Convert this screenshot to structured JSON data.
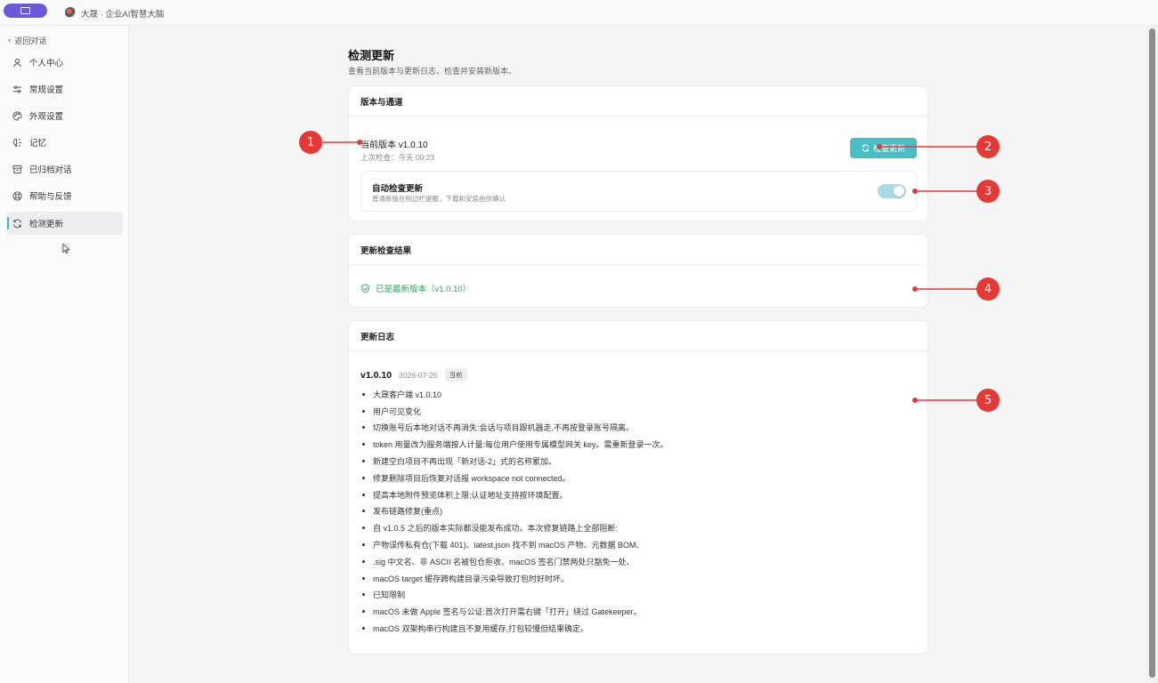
{
  "titlebar": {
    "app_title": "大晟 · 企业AI智慧大脑"
  },
  "sidebar": {
    "back_label": "返回对话",
    "items": [
      {
        "label": "个人中心",
        "icon": "user-icon"
      },
      {
        "label": "常规设置",
        "icon": "sliders-icon"
      },
      {
        "label": "外观设置",
        "icon": "palette-icon"
      },
      {
        "label": "记忆",
        "icon": "memory-icon"
      },
      {
        "label": "已归档对话",
        "icon": "archive-icon"
      },
      {
        "label": "帮助与反馈",
        "icon": "help-icon"
      },
      {
        "label": "检测更新",
        "icon": "refresh-icon",
        "active": true
      }
    ]
  },
  "page": {
    "title": "检测更新",
    "subtitle": "查看当前版本与更新日志，检查并安装新版本。"
  },
  "version_card": {
    "title": "版本与通道",
    "current_version": "当前版本 v1.0.10",
    "last_check": "上次检查：今天 00:23",
    "check_button": "检查更新",
    "auto_title": "自动检查更新",
    "auto_desc": "普通新版在侧边栏提醒，下载和安装由你确认",
    "auto_enabled": true
  },
  "result_card": {
    "title": "更新检查结果",
    "status": "已是最新版本（v1.0.10）"
  },
  "changelog_card": {
    "title": "更新日志",
    "version": "v1.0.10",
    "date": "2026-07-25",
    "badge": "当前",
    "notes": [
      "大晟客户端 v1.0.10",
      "用户可见变化",
      "切换账号后本地对话不再消失:会话与项目跟机器走,不再按登录账号隔离。",
      "token 用量改为服务端按人计量:每位用户使用专属模型网关 key。需重新登录一次。",
      "新建空白项目不再出现「新对话-2」式的名称累加。",
      "修复删除项目后恢复对话报 workspace not connected。",
      "提高本地附件预览体积上限;认证地址支持按环境配置。",
      "发布链路修复(重点)",
      "自 v1.0.5 之后的版本实际都没能发布成功。本次修复链路上全部阻断:",
      "产物误传私有仓(下载 401)、latest.json 找不到 macOS 产物、元数据 BOM、",
      ".sig 中文名、非 ASCII 名被包仓拒收、macOS 签名门禁两处只豁免一处、",
      "macOS target 缓存跨构建目录污染导致打包时好时坏。",
      "已知限制",
      "macOS 未做 Apple 签名与公证:首次打开需右键「打开」绕过 Gatekeeper。",
      "macOS 双架构串行构建且不复用缓存,打包较慢但结果确定。"
    ]
  },
  "annotations": [
    "1",
    "2",
    "3",
    "4",
    "5"
  ],
  "colors": {
    "accent": "#4bbec5",
    "success": "#37a267",
    "annotation": "#e53935",
    "brand": "#6b5ad8"
  }
}
